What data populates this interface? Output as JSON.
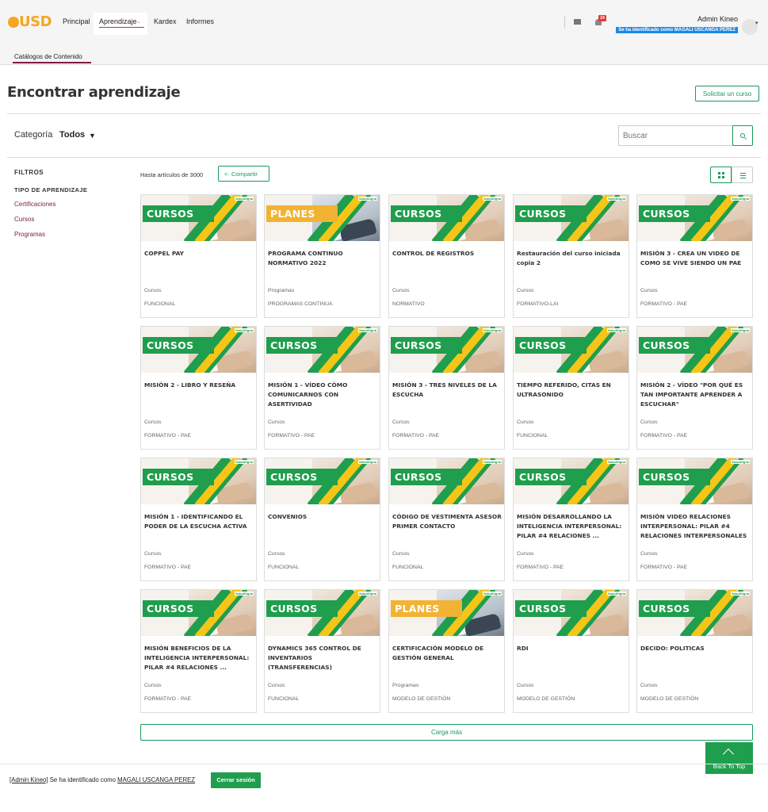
{
  "header": {
    "logo_text": "USD",
    "nav": [
      {
        "label": "Principal"
      },
      {
        "label": "Aprendizaje"
      },
      {
        "label": "Kardex"
      },
      {
        "label": "Informes"
      }
    ],
    "notifications_count": "24",
    "admin_name": "Admin Kineo",
    "impersonation_banner": "Se ha identificado como MAGALI USCANGA PEREZ"
  },
  "subnav": {
    "tab": "Catálogos de Contenido"
  },
  "page": {
    "title": "Encontrar aprendizaje",
    "request_course": "Solicitar un curso",
    "category_label": "Categoría",
    "category_value": "Todos",
    "search_placeholder": "Buscar"
  },
  "filters": {
    "title": "FILTROS",
    "section": "TIPO DE APRENDIZAJE",
    "items": [
      "Certificaciones",
      "Cursos",
      "Programas"
    ]
  },
  "results": {
    "count_text": "Hasta artículos de 3000",
    "share_label": "Compartir",
    "view_mode": "grid"
  },
  "cards": [
    {
      "banner": "CURSOS",
      "title": "COPPEL PAY",
      "type": "Cursos",
      "category": "FUNCIONAL"
    },
    {
      "banner": "PLANES",
      "title": "PROGRAMA CONTINUO NORMATIVO 2022",
      "type": "Programas",
      "category": "PROGRAMAS CONTINUA"
    },
    {
      "banner": "CURSOS",
      "title": "CONTROL DE REGISTROS",
      "type": "Cursos",
      "category": "NORMATIVO"
    },
    {
      "banner": "CURSOS",
      "title": "Restauración del curso iniciada copia 2",
      "type": "Cursos",
      "category": "FORMATIVO-LAI"
    },
    {
      "banner": "CURSOS",
      "title": "MISIÓN 3 - CREA UN VIDEO DE COMO SE VIVE SIENDO UN PAE",
      "type": "Cursos",
      "category": "FORMATIVO - PAE"
    },
    {
      "banner": "CURSOS",
      "title": "MISIÓN 2 - LIBRO Y RESEÑA",
      "type": "Cursos",
      "category": "FORMATIVO - PAE"
    },
    {
      "banner": "CURSOS",
      "title": "MISIÓN 1 - VÍDEO CÓMO COMUNICARNOS CON ASERTIVIDAD",
      "type": "Cursos",
      "category": "FORMATIVO - PAE"
    },
    {
      "banner": "CURSOS",
      "title": "MISIÓN 3 - TRES NIVELES DE LA ESCUCHA",
      "type": "Cursos",
      "category": "FORMATIVO - PAE"
    },
    {
      "banner": "CURSOS",
      "title": "TIEMPO REFERIDO, CITAS EN ULTRASONIDO",
      "type": "Cursos",
      "category": "FUNCIONAL"
    },
    {
      "banner": "CURSOS",
      "title": "MISIÓN 2 - VÍDEO \"POR QUÉ ES TAN IMPORTANTE APRENDER A ESCUCHAR\"",
      "type": "Cursos",
      "category": "FORMATIVO - PAE"
    },
    {
      "banner": "CURSOS",
      "title": "MISIÓN 1 - IDENTIFICANDO EL PODER DE LA ESCUCHA ACTIVA",
      "type": "Cursos",
      "category": "FORMATIVO - PAE"
    },
    {
      "banner": "CURSOS",
      "title": "CONVENIOS",
      "type": "Cursos",
      "category": "FUNCIONAL"
    },
    {
      "banner": "CURSOS",
      "title": "CÓDIGO DE VESTIMENTA ASESOR PRIMER CONTACTO",
      "type": "Cursos",
      "category": "FUNCIONAL"
    },
    {
      "banner": "CURSOS",
      "title": "MISIÓN DESARROLLANDO LA INTELIGENCIA INTERPERSONAL: PILAR #4 RELACIONES ...",
      "type": "Cursos",
      "category": "FORMATIVO - PAE"
    },
    {
      "banner": "CURSOS",
      "title": "MISIÓN VIDEO RELACIONES INTERPERSONAL: PILAR #4 RELACIONES INTERPERSONALES",
      "type": "Cursos",
      "category": "FORMATIVO - PAE"
    },
    {
      "banner": "CURSOS",
      "title": "MISIÓN BENEFICIOS DE LA INTELIGENCIA INTERPERSONAL: PILAR #4 RELACIONES ...",
      "type": "Cursos",
      "category": "FORMATIVO - PAE"
    },
    {
      "banner": "CURSOS",
      "title": "DYNAMICS 365 CONTROL DE INVENTARIOS (TRANSFERENCIAS)",
      "type": "Cursos",
      "category": "FUNCIONAL"
    },
    {
      "banner": "PLANES",
      "title": "CERTIFICACIÓN MODELO DE GESTIÓN GENERAL",
      "type": "Programas",
      "category": "MODELO DE GESTIÓN"
    },
    {
      "banner": "CURSOS",
      "title": "RDI",
      "type": "Cursos",
      "category": "MODELO DE GESTIÓN"
    },
    {
      "banner": "CURSOS",
      "title": "DECIDO: POLITICAS",
      "type": "Cursos",
      "category": "MODELO DE GESTIÓN"
    }
  ],
  "load_more": "Carga más",
  "back_to_top": "Back To Top",
  "footer": {
    "admin_link": "[Admin Kineo]",
    "text": "Se ha identificado como",
    "user_link": "MAGALI USCANGA PEREZ",
    "logout": "Cerrar sesión"
  },
  "colors": {
    "accent": "#1a9a5a",
    "brand": "#f5a623",
    "link": "#7b1c45",
    "planes": "#f2b233"
  }
}
